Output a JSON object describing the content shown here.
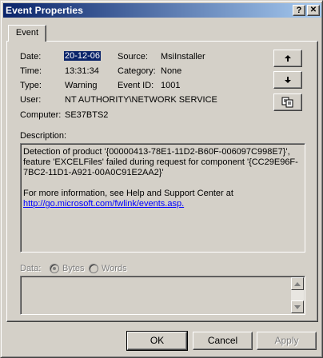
{
  "window": {
    "title": "Event Properties",
    "help_glyph": "?",
    "close_glyph": "✕"
  },
  "tabs": [
    {
      "label": "Event"
    }
  ],
  "event": {
    "date_label": "Date:",
    "date_value": "20-12-06",
    "time_label": "Time:",
    "time_value": "13:31:34",
    "type_label": "Type:",
    "type_value": "Warning",
    "user_label": "User:",
    "user_value": "NT AUTHORITY\\NETWORK SERVICE",
    "computer_label": "Computer:",
    "computer_value": "SE37BTS2",
    "source_label": "Source:",
    "source_value": "MsiInstaller",
    "category_label": "Category:",
    "category_value": "None",
    "eventid_label": "Event ID:",
    "eventid_value": "1001"
  },
  "description": {
    "label": "Description:",
    "line1": "Detection of product '{00000413-78E1-11D2-B60F-006097C998E7}',",
    "line2": "feature 'EXCELFiles' failed during request for component '{CC29E96F-",
    "line3": "7BC2-11D1-A921-00A0C91E2AA2}'",
    "line4": "For more information, see Help and Support Center at",
    "link": "http://go.microsoft.com/fwlink/events.asp."
  },
  "data_section": {
    "label": "Data:",
    "bytes_label": "Bytes",
    "words_label": "Words"
  },
  "nav": {
    "up_icon": "arrow-up-icon",
    "down_icon": "arrow-down-icon",
    "copy_icon": "copy-icon"
  },
  "buttons": {
    "ok": "OK",
    "cancel": "Cancel",
    "apply": "Apply"
  },
  "colors": {
    "title_start": "#0a246a",
    "title_end": "#a6caf0",
    "face": "#d4d0c8",
    "link": "#0000ff",
    "selection": "#0a246a"
  }
}
